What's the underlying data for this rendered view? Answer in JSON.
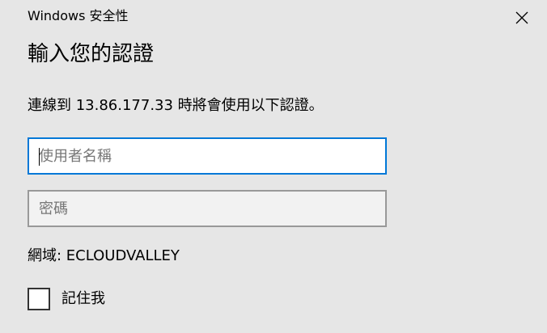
{
  "window": {
    "title": "Windows 安全性",
    "close_icon": "close-icon"
  },
  "dialog": {
    "heading": "輸入您的認證",
    "message": "連線到 13.86.177.33 時將會使用以下認證。",
    "username": {
      "value": "",
      "placeholder": "使用者名稱"
    },
    "password": {
      "value": "",
      "placeholder": "密碼"
    },
    "domain_text": "網域: ECLOUDVALLEY",
    "remember": {
      "label": "記住我",
      "checked": false
    }
  },
  "colors": {
    "background": "#e6e6e6",
    "focus_border": "#0078d7",
    "field_border": "#999999"
  }
}
